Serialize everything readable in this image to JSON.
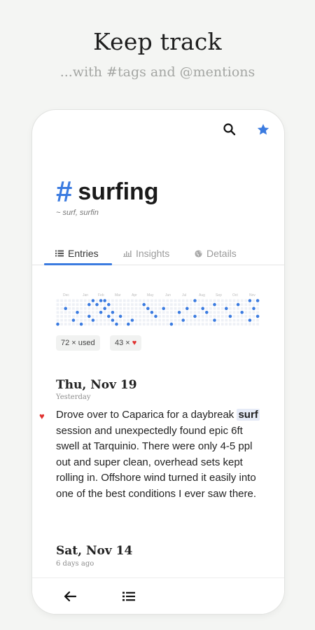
{
  "promo": {
    "title": "Keep track",
    "subtitle": "...with #tags and @mentions"
  },
  "toolbar": {
    "search_icon": "search-icon",
    "star_icon": "star-icon",
    "star_color": "#3b7be0"
  },
  "tag": {
    "hash": "#",
    "name": "surfing",
    "aliases": "~ surf, surfin",
    "accent_color": "#3b7be0"
  },
  "tabs": [
    {
      "label": "Entries",
      "icon": "list-icon",
      "active": true
    },
    {
      "label": "Insights",
      "icon": "bar-chart-icon",
      "active": false
    },
    {
      "label": "Details",
      "icon": "globe-icon",
      "active": false
    }
  ],
  "activity": {
    "month_labels": [
      "Dec",
      "Jan",
      "Feb",
      "Mar",
      "Apr",
      "May",
      "Jun",
      "Jul",
      "Aug",
      "Sep",
      "Oct",
      "Nov"
    ],
    "dot_color": "#3b7be0",
    "empty_color": "#eef1f6"
  },
  "stats": {
    "used": "72 × used",
    "hearted": "43 ×",
    "heart_icon": "heart-icon",
    "heart_color": "#e0312f"
  },
  "entries": [
    {
      "date": "Thu, Nov 19",
      "relative": "Yesterday",
      "favorite": true,
      "text_before": "Drove over to Caparica for a daybreak ",
      "highlight": "surf",
      "text_after": " session and unexpectedly found epic 6ft swell at Tarquinio. There were only 4-5 ppl out and super clean, overhead sets kept rolling in. Offshore wind turned it easily into one of the best conditions I ever saw there."
    },
    {
      "date": "Sat, Nov 14",
      "relative": "6 days ago"
    }
  ],
  "bottom_bar": {
    "back_icon": "back-arrow-icon",
    "list_icon": "list-icon"
  }
}
